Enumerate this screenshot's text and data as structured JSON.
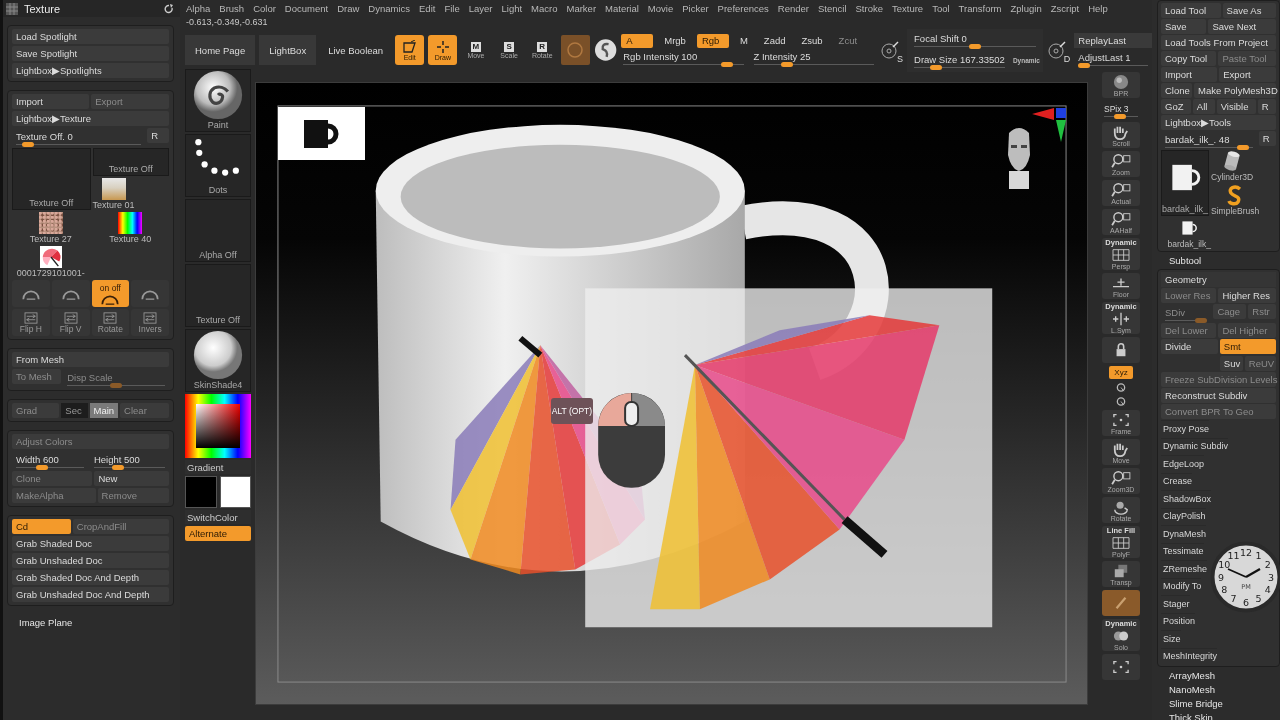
{
  "menu_bar": [
    "Alpha",
    "Brush",
    "Color",
    "Document",
    "Draw",
    "Dynamics",
    "Edit",
    "File",
    "Layer",
    "Light",
    "Macro",
    "Marker",
    "Material",
    "Movie",
    "Picker",
    "Preferences",
    "Render",
    "Stencil",
    "Stroke",
    "Texture",
    "Tool",
    "Transform",
    "Zplugin",
    "Zscript",
    "Help"
  ],
  "coordinates": "-0.613,-0.349,-0.631",
  "texture_palette": {
    "title": "Texture",
    "sections": [
      {
        "kind": "group",
        "rows": [
          [
            {
              "kind": "button",
              "label": "Load Spotlight",
              "disabled": false
            }
          ],
          [
            {
              "kind": "button",
              "label": "Save Spotlight",
              "disabled": false
            }
          ],
          [
            {
              "kind": "button",
              "label": "Lightbox▶Spotlights",
              "disabled": false
            }
          ]
        ]
      },
      {
        "kind": "group",
        "rows": [
          [
            {
              "kind": "button",
              "label": "Import",
              "disabled": false
            },
            {
              "kind": "button",
              "label": "Export",
              "disabled": true
            }
          ],
          [
            {
              "kind": "button",
              "label": "Lightbox▶Texture",
              "disabled": false
            }
          ],
          [
            {
              "kind": "slider",
              "label": "Texture Off. 0",
              "level": 0.05,
              "disabled": false
            },
            {
              "kind": "button",
              "label": "R",
              "disabled": false
            }
          ],
          [
            {
              "kind": "slot",
              "label": "Texture Off"
            },
            {
              "kind": "stack",
              "rows": [
                [
                  {
                    "kind": "slot",
                    "label": "Texture Off"
                  }
                ],
                [
                  {
                    "kind": "room",
                    "label": "Texture 01"
                  }
                ]
              ]
            }
          ],
          [
            {
              "kind": "noise",
              "label": "Texture 27"
            },
            {
              "kind": "spectrum",
              "label": "Texture 40"
            }
          ],
          [
            {
              "kind": "umbrella",
              "label": "0001729101001-"
            }
          ],
          [
            {
              "kind": "arc_toggle",
              "on": false,
              "disabled": true
            },
            {
              "kind": "arc_toggle",
              "on": false,
              "disabled": true
            },
            {
              "kind": "arc_toggle",
              "label": "on off",
              "on": true,
              "disabled": false
            },
            {
              "kind": "arc_toggle",
              "on": false,
              "disabled": true
            }
          ],
          [
            {
              "kind": "flip_tool",
              "label": "Flip H",
              "disabled": true
            },
            {
              "kind": "flip_tool",
              "label": "Flip V",
              "disabled": true
            },
            {
              "kind": "flip_tool",
              "label": "Rotate",
              "disabled": true
            },
            {
              "kind": "flip_tool",
              "label": "Invers",
              "disabled": true
            }
          ]
        ]
      },
      {
        "kind": "group",
        "rows": [
          [
            {
              "kind": "button",
              "label": "From Mesh",
              "disabled": false
            }
          ],
          [
            {
              "kind": "button",
              "label": "To Mesh",
              "disabled": true
            },
            {
              "kind": "slider",
              "label": "Disp Scale",
              "level": 0.5,
              "disabled": true
            }
          ]
        ]
      },
      {
        "kind": "group",
        "rows": [
          [
            {
              "kind": "button",
              "label": "Grad",
              "disabled": true
            },
            {
              "kind": "well",
              "label": "Sec",
              "selected": false
            },
            {
              "kind": "well",
              "label": "Main",
              "selected": true
            },
            {
              "kind": "button",
              "label": "Clear",
              "disabled": true
            }
          ]
        ]
      },
      {
        "kind": "group",
        "rows": [
          [
            {
              "kind": "button",
              "label": "Adjust Colors",
              "disabled": true
            }
          ],
          [
            {
              "kind": "slider",
              "label": "Width 600",
              "level": 0.35,
              "disabled": false
            },
            {
              "kind": "slider",
              "label": "Height 500",
              "level": 0.3,
              "disabled": false
            }
          ],
          [
            {
              "kind": "button",
              "label": "Clone",
              "disabled": true
            },
            {
              "kind": "button",
              "label": "New",
              "disabled": false
            }
          ],
          [
            {
              "kind": "button",
              "label": "MakeAlpha",
              "disabled": true
            },
            {
              "kind": "button",
              "label": "Remove",
              "disabled": true
            }
          ]
        ]
      },
      {
        "kind": "group",
        "rows": [
          [
            {
              "kind": "button",
              "label": "Cd",
              "on": true,
              "disabled": false
            },
            {
              "kind": "button",
              "label": "CropAndFill",
              "on": false,
              "disabled": true
            }
          ],
          [
            {
              "kind": "button",
              "label": "Grab Shaded Doc",
              "disabled": false
            }
          ],
          [
            {
              "kind": "button",
              "label": "Grab Unshaded Doc",
              "disabled": false
            }
          ],
          [
            {
              "kind": "button",
              "label": "Grab Shaded Doc And Depth",
              "disabled": false
            }
          ],
          [
            {
              "kind": "button",
              "label": "Grab Unshaded Doc And Depth",
              "disabled": false
            }
          ]
        ]
      },
      {
        "kind": "header",
        "label": "Image Plane"
      }
    ]
  },
  "toolbar": {
    "nav": [
      {
        "label": "Home Page"
      },
      {
        "label": "LightBox"
      }
    ],
    "live_boolean": "Live Boolean",
    "tools": [
      {
        "kind": "edit",
        "label": "Edit",
        "on": true
      },
      {
        "kind": "draw",
        "label": "Draw",
        "on": true
      },
      {
        "kind": "key",
        "label": "Move",
        "key": "M",
        "on": false
      },
      {
        "kind": "key",
        "label": "Scale",
        "key": "S",
        "on": false
      },
      {
        "kind": "key",
        "label": "Rotate",
        "key": "R",
        "on": false
      }
    ],
    "modes": [
      {
        "label": "A",
        "on": true,
        "disabled": false
      },
      {
        "label": "Mrgb",
        "on": false,
        "disabled": false
      },
      {
        "label": "Rgb",
        "on": true,
        "disabled": false
      },
      {
        "label": "M",
        "on": false,
        "disabled": false
      },
      {
        "label": "Zadd",
        "on": false,
        "disabled": false
      },
      {
        "label": "Zsub",
        "on": false,
        "disabled": false
      },
      {
        "label": "Zcut",
        "on": false,
        "disabled": true
      }
    ],
    "rgb_intensity": {
      "label": "Rgb Intensity 100",
      "level": 0.9
    },
    "z_intensity": {
      "label": "Z Intensity 25",
      "level": 0.25
    },
    "lazy_key": "S",
    "focal_shift": {
      "label": "Focal Shift 0",
      "level": 0.5
    },
    "draw_size": {
      "label": "Draw Size 167.33502",
      "level": 0.2
    },
    "dynamic": "Dynamic",
    "draw_key": "D",
    "replay_last": "ReplayLast",
    "adjust_last": {
      "label": "AdjustLast 1",
      "level": 0
    }
  },
  "tool_column": [
    {
      "kind": "spiral",
      "label": "Paint"
    },
    {
      "kind": "dots",
      "label": "Dots"
    },
    {
      "kind": "slot",
      "label": "Alpha Off"
    },
    {
      "kind": "slot",
      "label": "Texture Off"
    },
    {
      "kind": "sphere",
      "label": "SkinShade4"
    },
    {
      "kind": "picker"
    },
    {
      "kind": "text",
      "label": "Gradient"
    },
    {
      "kind": "swatches",
      "colors": [
        {
          "color": "#000000"
        },
        {
          "color": "#ffffff"
        }
      ]
    },
    {
      "kind": "text",
      "label": "SwitchColor"
    },
    {
      "kind": "button",
      "label": "Alternate",
      "on": true
    }
  ],
  "canvas": {
    "badge": "ALT (OPT)"
  },
  "right_shelf": [
    {
      "kind": "sphere",
      "label": "BPR",
      "on": false
    },
    {
      "kind": "slider",
      "label": "SPix 3",
      "level": 0.45
    },
    {
      "kind": "hand",
      "label": "Scroll",
      "on": false
    },
    {
      "kind": "magnifier",
      "label": "Zoom",
      "on": false
    },
    {
      "kind": "magnifier",
      "label": "Actual",
      "on": false
    },
    {
      "kind": "magnifier",
      "label": "AAHalf",
      "on": false
    },
    {
      "kind": "grid",
      "label": "Persp",
      "caption": "Dynamic",
      "on": false
    },
    {
      "kind": "floor",
      "label": "Floor",
      "on": false
    },
    {
      "kind": "symmetry",
      "label": "L.Sym",
      "caption": "Dynamic",
      "on": false
    },
    {
      "kind": "lock",
      "on": false
    },
    {
      "kind": "toggle",
      "label": "Xyz",
      "on": true
    },
    {
      "kind": "mini"
    },
    {
      "kind": "mini"
    },
    {
      "kind": "frame",
      "label": "Frame",
      "on": false
    },
    {
      "kind": "hand",
      "label": "Move",
      "on": false
    },
    {
      "kind": "magnifier",
      "label": "Zoom3D",
      "on": false
    },
    {
      "kind": "rotate",
      "label": "Rotate",
      "on": false
    },
    {
      "kind": "grid",
      "label": "PolyF",
      "caption": "Line Fill",
      "on": false
    },
    {
      "kind": "cube",
      "label": "Transp",
      "on": false
    },
    {
      "kind": "ghost",
      "on": true
    },
    {
      "kind": "spheres",
      "label": "Solo",
      "caption": "Dynamic",
      "on": false
    },
    {
      "kind": "frame",
      "on": false
    }
  ],
  "tool_palette": {
    "sections": [
      {
        "kind": "group",
        "rows": [
          [
            {
              "kind": "button",
              "label": "Load Tool",
              "disabled": false
            },
            {
              "kind": "button",
              "label": "Save As",
              "disabled": false
            }
          ],
          [
            {
              "kind": "button",
              "label": "Save",
              "disabled": false
            },
            {
              "kind": "button",
              "label": "Save Next",
              "disabled": false
            }
          ],
          [
            {
              "kind": "button",
              "label": "Load Tools From Project",
              "disabled": false
            }
          ],
          [
            {
              "kind": "button",
              "label": "Copy Tool",
              "disabled": false
            },
            {
              "kind": "button",
              "label": "Paste Tool",
              "disabled": true
            }
          ],
          [
            {
              "kind": "button",
              "label": "Import",
              "disabled": false
            },
            {
              "kind": "button",
              "label": "Export",
              "disabled": false
            }
          ],
          [
            {
              "kind": "button",
              "label": "Clone",
              "disabled": false
            },
            {
              "kind": "button",
              "label": "Make PolyMesh3D",
              "disabled": false
            }
          ],
          [
            {
              "kind": "button",
              "label": "GoZ",
              "disabled": false
            },
            {
              "kind": "button",
              "label": "All",
              "disabled": false
            },
            {
              "kind": "button",
              "label": "Visible",
              "disabled": false
            },
            {
              "kind": "button",
              "label": "R",
              "disabled": false
            }
          ],
          [
            {
              "kind": "button",
              "label": "Lightbox▶Tools",
              "disabled": false
            }
          ],
          [
            {
              "kind": "slider",
              "label": "bardak_ilk_. 48",
              "level": 0.95,
              "disabled": false
            },
            {
              "kind": "button",
              "label": "R",
              "disabled": false
            }
          ],
          [
            {
              "kind": "mug_tile",
              "label": "bardak_ilk_"
            },
            {
              "kind": "stack",
              "rows": [
                [
                  {
                    "kind": "cylinder",
                    "label": "Cylinder3D"
                  }
                ],
                [
                  {
                    "kind": "swirl",
                    "label": "SimpleBrush"
                  }
                ]
              ]
            }
          ],
          [
            {
              "kind": "mug",
              "label": "bardak_ilk_"
            }
          ]
        ]
      },
      {
        "kind": "header",
        "label": "Subtool"
      },
      {
        "kind": "group",
        "title": "Geometry",
        "rows": [
          [
            {
              "kind": "button",
              "label": "Lower Res",
              "disabled": true
            },
            {
              "kind": "button",
              "label": "Higher Res",
              "disabled": false
            }
          ],
          [
            {
              "kind": "slider",
              "label": "SDiv",
              "level": 1,
              "disabled": true
            },
            {
              "kind": "button",
              "label": "Cage",
              "disabled": true
            },
            {
              "kind": "button",
              "label": "Rstr",
              "disabled": true
            }
          ],
          [
            {
              "kind": "button",
              "label": "Del Lower",
              "disabled": true
            },
            {
              "kind": "button",
              "label": "Del Higher",
              "disabled": true
            }
          ],
          [
            {
              "kind": "button",
              "label": "Divide",
              "disabled": false
            },
            {
              "kind": "stack",
              "rows": [
                [
                  {
                    "kind": "button",
                    "label": "Smt",
                    "on": true
                  }
                ],
                [
                  {
                    "kind": "button",
                    "label": "Suv",
                    "on": false,
                    "disabled": false
                  },
                  {
                    "kind": "button",
                    "label": "ReUV",
                    "on": false,
                    "disabled": true
                  }
                ]
              ]
            }
          ],
          [
            {
              "kind": "button",
              "label": "Freeze SubDivision Levels",
              "disabled": true
            }
          ],
          [
            {
              "kind": "button",
              "label": "Reconstruct Subdiv",
              "disabled": false
            }
          ],
          [
            {
              "kind": "button",
              "label": "Convert BPR To Geo",
              "disabled": true
            }
          ],
          [
            {
              "kind": "sub",
              "label": "Proxy Pose"
            }
          ],
          [
            {
              "kind": "sub",
              "label": "Dynamic Subdiv"
            }
          ],
          [
            {
              "kind": "sub",
              "label": "EdgeLoop"
            }
          ],
          [
            {
              "kind": "sub",
              "label": "Crease"
            }
          ],
          [
            {
              "kind": "sub",
              "label": "ShadowBox"
            }
          ],
          [
            {
              "kind": "sub",
              "label": "ClayPolish"
            }
          ],
          [
            {
              "kind": "sub",
              "label": "DynaMesh"
            }
          ],
          [
            {
              "kind": "sub",
              "label": "Tessimate"
            }
          ],
          [
            {
              "kind": "sub",
              "label": "ZRemeshe"
            }
          ],
          [
            {
              "kind": "sub",
              "label": "Modify To"
            }
          ],
          [
            {
              "kind": "sub",
              "label": "Stager"
            }
          ],
          [
            {
              "kind": "sub",
              "label": "Position"
            }
          ],
          [
            {
              "kind": "sub",
              "label": "Size"
            }
          ],
          [
            {
              "kind": "sub",
              "label": "MeshIntegrity"
            }
          ]
        ]
      },
      {
        "kind": "header",
        "label": "ArrayMesh"
      },
      {
        "kind": "header",
        "label": "NanoMesh"
      },
      {
        "kind": "header",
        "label": "Slime Bridge"
      },
      {
        "kind": "header",
        "label": "Thick Skin"
      }
    ]
  },
  "clock": {
    "numerals": [
      "11",
      "12",
      "1",
      "10",
      "2",
      "9",
      "3",
      "8",
      "4",
      "7",
      "6",
      "5"
    ],
    "period": "PM"
  }
}
